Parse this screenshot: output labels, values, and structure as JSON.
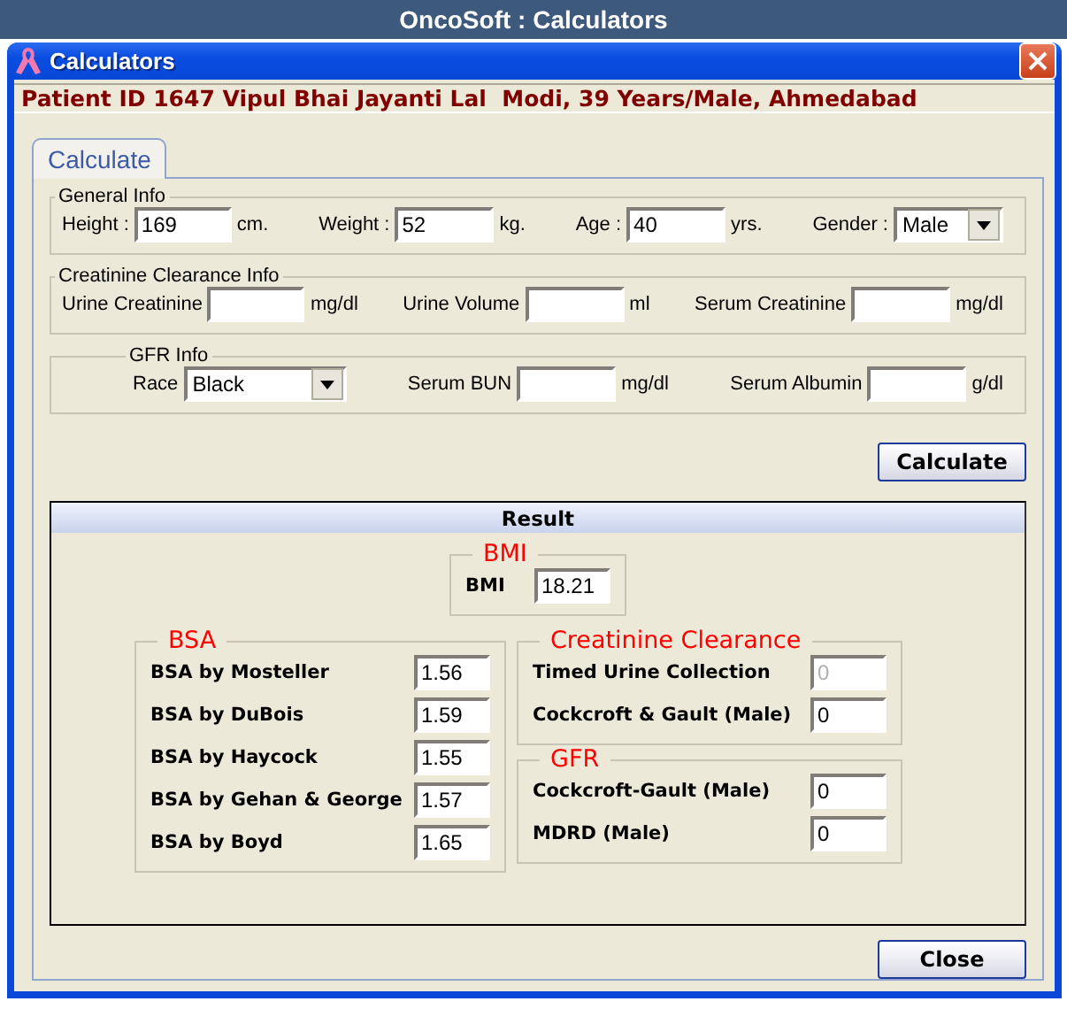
{
  "app_title": "OncoSoft : Calculators",
  "window": {
    "title": "Calculators"
  },
  "patient_banner": "Patient ID 1647 Vipul Bhai Jayanti Lal  Modi, 39 Years/Male, Ahmedabad",
  "tabs": [
    {
      "label": "Calculate",
      "selected": true
    }
  ],
  "groups": [
    {
      "title": "General Info",
      "fields": [
        {
          "kind": "input",
          "label": "Height :",
          "value": "169",
          "unit": "cm."
        },
        {
          "kind": "input",
          "label": "Weight :",
          "value": "52",
          "unit": "kg."
        },
        {
          "kind": "input",
          "label": "Age :",
          "value": "40",
          "unit": "yrs."
        },
        {
          "kind": "select",
          "label": "Gender :",
          "value": "Male"
        }
      ]
    },
    {
      "title": "Creatinine Clearance Info",
      "fields": [
        {
          "kind": "input",
          "label": "Urine Creatinine",
          "unit": "mg/dl"
        },
        {
          "kind": "input",
          "label": "Urine Volume",
          "unit": "ml"
        },
        {
          "kind": "input",
          "label": "Serum Creatinine",
          "unit": "mg/dl"
        }
      ]
    },
    {
      "title": "GFR Info",
      "fields": [
        {
          "kind": "select",
          "label": "Race",
          "value": "Black"
        },
        {
          "kind": "input",
          "label": "Serum BUN",
          "unit": "mg/dl"
        },
        {
          "kind": "input",
          "label": "Serum Albumin",
          "unit": "g/dl"
        }
      ]
    }
  ],
  "calculate_button": "Calculate",
  "result": {
    "title": "Result",
    "bmi": {
      "title": "BMI",
      "label": "BMI",
      "value": "18.21"
    },
    "bsa": {
      "title": "BSA",
      "rows": [
        {
          "label": "BSA by Mosteller",
          "value": "1.56"
        },
        {
          "label": "BSA by DuBois",
          "value": "1.59"
        },
        {
          "label": "BSA by Haycock",
          "value": "1.55"
        },
        {
          "label": "BSA by Gehan & George",
          "value": "1.57"
        },
        {
          "label": "BSA by Boyd",
          "value": "1.65"
        }
      ]
    },
    "creatinine_clearance": {
      "title": "Creatinine Clearance",
      "rows": [
        {
          "label": "Timed Urine Collection",
          "value": "0",
          "disabled": true
        },
        {
          "label": "Cockcroft & Gault (Male)",
          "value": "0",
          "disabled": false
        }
      ]
    },
    "gfr": {
      "title": "GFR",
      "rows": [
        {
          "label": "Cockcroft-Gault (Male)",
          "value": "0",
          "disabled": false
        },
        {
          "label": "MDRD (Male)",
          "value": "0",
          "disabled": false
        }
      ]
    }
  },
  "close_button": "Close"
}
